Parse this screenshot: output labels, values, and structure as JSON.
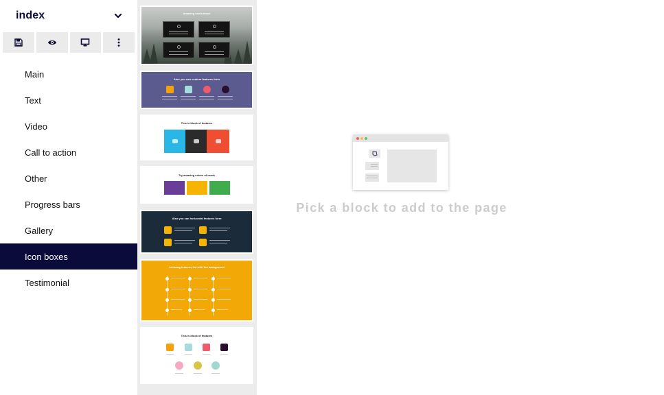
{
  "page_select": {
    "name": "index"
  },
  "toolbar": {
    "buttons": [
      {
        "icon": "save-icon"
      },
      {
        "icon": "eye-icon"
      },
      {
        "icon": "desktop-icon"
      },
      {
        "icon": "more-vertical-icon"
      }
    ]
  },
  "nav": {
    "items": [
      "Main",
      "Text",
      "Video",
      "Call to action",
      "Other",
      "Progress bars",
      "Gallery",
      "Icon boxes",
      "Testimonial"
    ],
    "active": "Icon boxes"
  },
  "thumbnails": [
    {
      "title": "Amazing cards block"
    },
    {
      "title": "Also you can custom features form"
    },
    {
      "title": "This is block of features"
    },
    {
      "title": "Try amazing colors of cards"
    },
    {
      "title": "Also you can horizontal features form"
    },
    {
      "title": "Amazing features list with fon background"
    },
    {
      "title": "This is block of features"
    }
  ],
  "main": {
    "empty_message": "Pick a block to add to the page"
  },
  "colors": {
    "active_nav": "#0b0b3b",
    "purple_block": "#5c5b8f",
    "dark_navy_block": "#1c2b3a",
    "orange_block": "#f2a807",
    "cyan": "#2ab7e6",
    "red": "#f04e33",
    "green": "#3fad4c",
    "violet": "#6a3d9a",
    "yellow": "#f4b400"
  }
}
